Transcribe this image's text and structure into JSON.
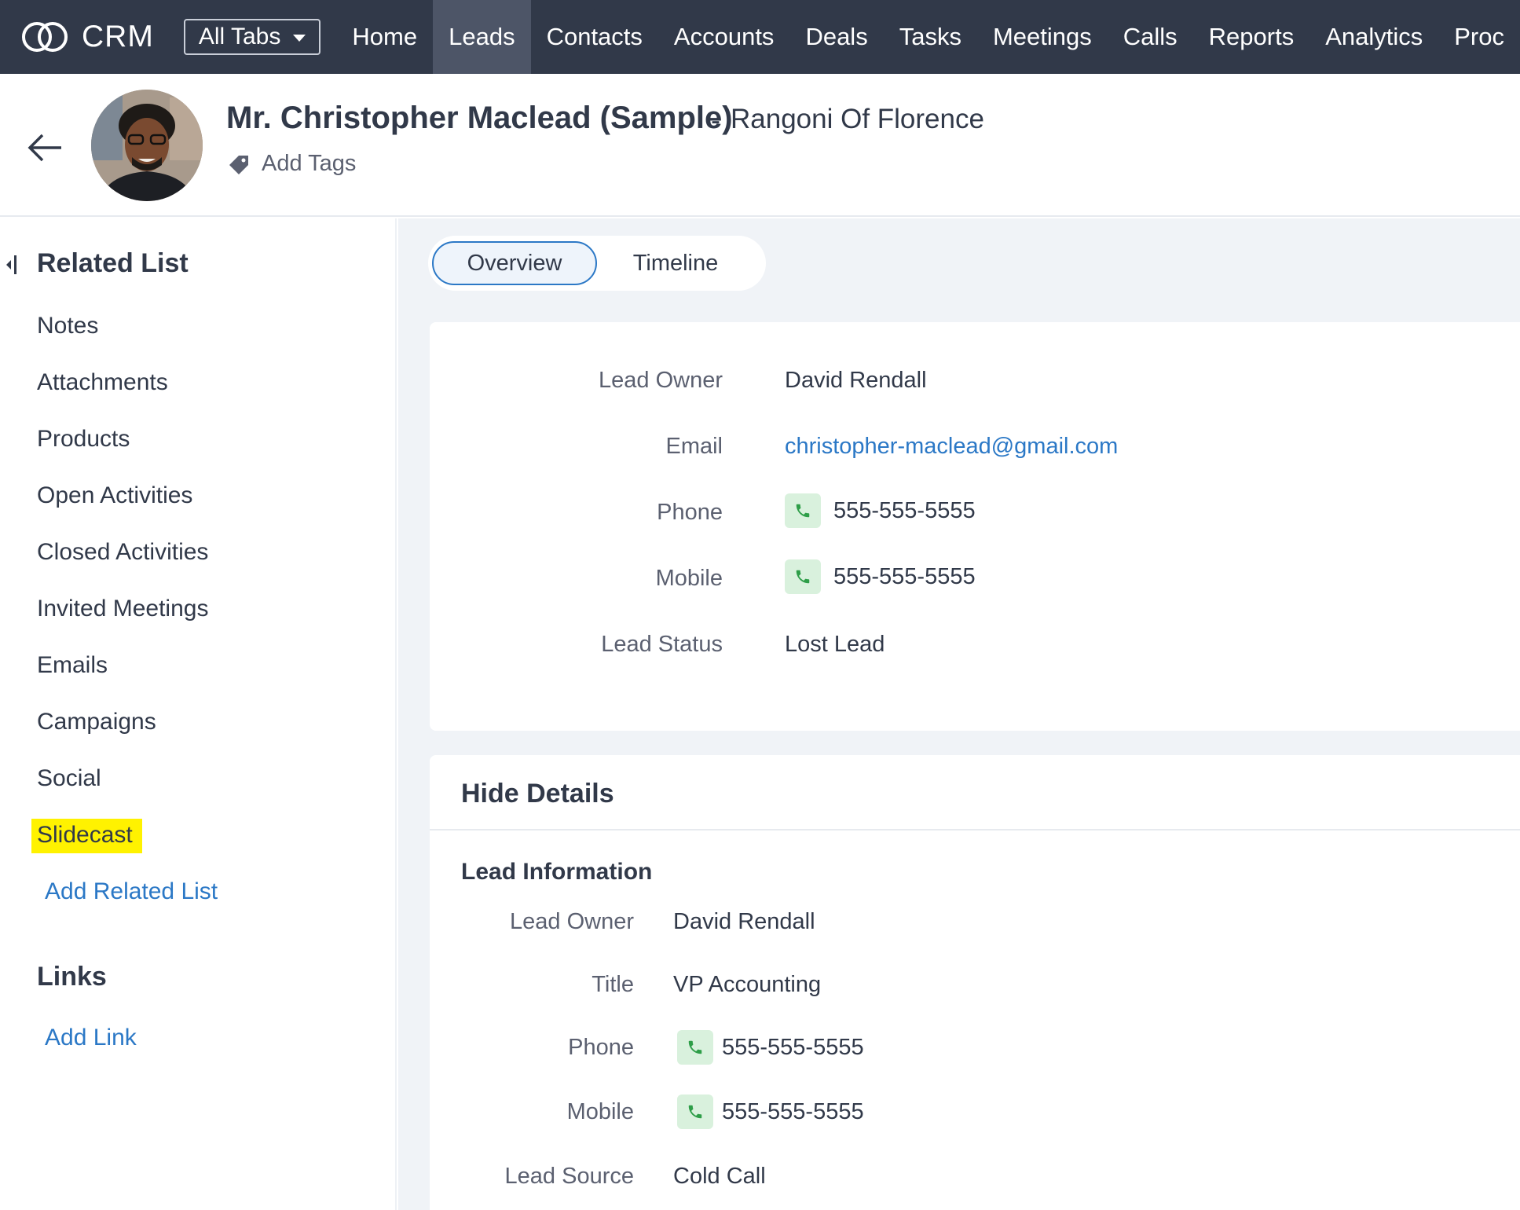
{
  "nav": {
    "brand": "CRM",
    "all_tabs": "All Tabs",
    "items": [
      {
        "label": "Home"
      },
      {
        "label": "Leads"
      },
      {
        "label": "Contacts"
      },
      {
        "label": "Accounts"
      },
      {
        "label": "Deals"
      },
      {
        "label": "Tasks"
      },
      {
        "label": "Meetings"
      },
      {
        "label": "Calls"
      },
      {
        "label": "Reports"
      },
      {
        "label": "Analytics"
      },
      {
        "label": "Proc"
      }
    ],
    "active_item": "Leads"
  },
  "record": {
    "name": "Mr. Christopher Maclead (Sample)",
    "separator": "-",
    "company": "Rangoni Of Florence",
    "add_tags": "Add Tags"
  },
  "sidebar": {
    "related_heading": "Related List",
    "items": [
      {
        "label": "Notes"
      },
      {
        "label": "Attachments"
      },
      {
        "label": "Products"
      },
      {
        "label": "Open Activities"
      },
      {
        "label": "Closed Activities"
      },
      {
        "label": "Invited Meetings"
      },
      {
        "label": "Emails"
      },
      {
        "label": "Campaigns"
      },
      {
        "label": "Social"
      },
      {
        "label": "Slidecast"
      }
    ],
    "highlighted_item": "Slidecast",
    "add_related": "Add Related List",
    "links_heading": "Links",
    "add_link": "Add Link"
  },
  "tabs": {
    "overview": "Overview",
    "timeline": "Timeline",
    "active": "Overview"
  },
  "overview": {
    "fields": [
      {
        "label": "Lead Owner",
        "value": "David Rendall"
      },
      {
        "label": "Email",
        "value": "christopher-maclead@gmail.com"
      },
      {
        "label": "Phone",
        "value": "555-555-5555"
      },
      {
        "label": "Mobile",
        "value": "555-555-5555"
      },
      {
        "label": "Lead Status",
        "value": "Lost Lead"
      }
    ]
  },
  "details": {
    "toggle_label": "Hide Details",
    "section_title": "Lead Information",
    "fields": [
      {
        "label": "Lead Owner",
        "value": "David Rendall"
      },
      {
        "label": "Title",
        "value": "VP Accounting"
      },
      {
        "label": "Phone",
        "value": "555-555-5555"
      },
      {
        "label": "Mobile",
        "value": "555-555-5555"
      },
      {
        "label": "Lead Source",
        "value": "Cold Call"
      }
    ]
  },
  "colors": {
    "nav_bg": "#313949",
    "nav_active": "#4d5567",
    "link": "#2b78c6",
    "highlight": "#fff200",
    "phone_badge": "#d9f1dd",
    "main_bg": "#f0f3f7"
  },
  "icons": [
    "crm-logo-icon",
    "chevron-down-icon",
    "back-arrow-icon",
    "tag-icon",
    "collapse-panel-icon",
    "phone-icon"
  ]
}
